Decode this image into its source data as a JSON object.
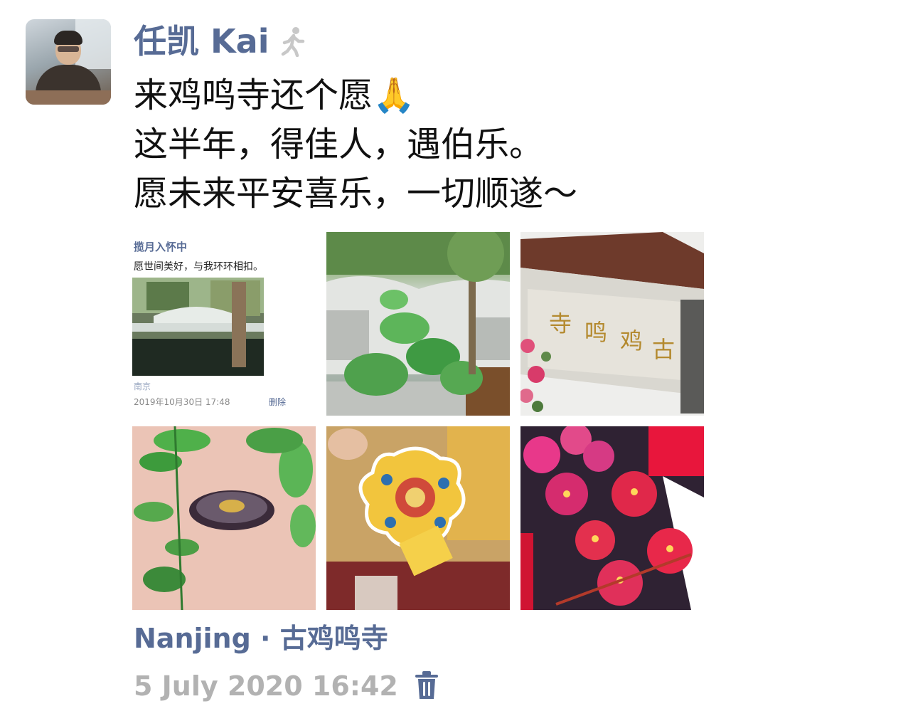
{
  "post": {
    "author": "任凯 Kai",
    "text_lines": [
      "来鸡鸣寺还个愿🙏",
      "这半年，得佳人，遇伯乐。",
      "愿未来平安喜乐，一切顺遂～"
    ],
    "location": "Nanjing · 古鸡鸣寺",
    "timestamp": "5 July 2020 16:42"
  },
  "embedded_screenshot": {
    "author": "揽月入怀中",
    "text": "愿世间美好，与我环环相扣。",
    "location": "南京",
    "timestamp": "2019年10月30日 17:48",
    "delete": "删除"
  },
  "photos": [
    {
      "name": "photo-screenshot"
    },
    {
      "name": "photo-lotus-plant"
    },
    {
      "name": "photo-temple-gate"
    },
    {
      "name": "photo-wheel-leaves"
    },
    {
      "name": "photo-flower-charm"
    },
    {
      "name": "photo-candles"
    }
  ],
  "colors": {
    "link": "#576b95",
    "text": "#111111",
    "muted": "#b2b2b2"
  },
  "icons": [
    "walking-person-icon",
    "trash-icon"
  ]
}
